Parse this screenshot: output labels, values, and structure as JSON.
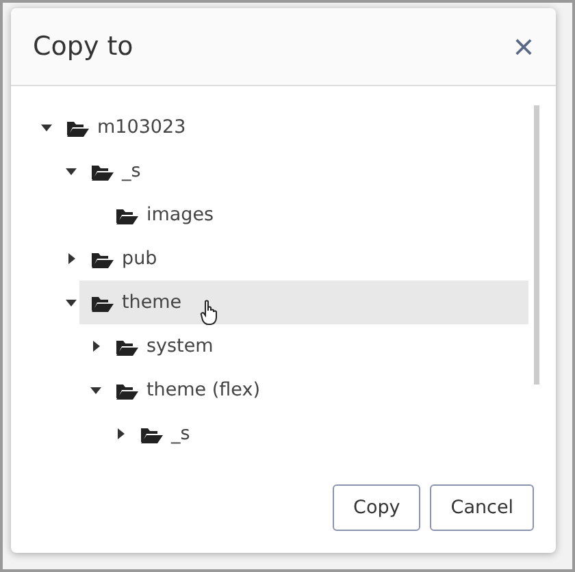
{
  "dialog": {
    "title": "Copy to",
    "close": "×"
  },
  "tree": [
    {
      "label": "m103023",
      "expanded": true,
      "selected": false,
      "children": [
        {
          "label": "_s",
          "expanded": true,
          "selected": false,
          "children": [
            {
              "label": "images",
              "selected": false
            }
          ]
        },
        {
          "label": "pub",
          "expanded": false,
          "selected": false
        },
        {
          "label": "theme",
          "expanded": true,
          "selected": true,
          "children": [
            {
              "label": "system",
              "expanded": false,
              "selected": false
            },
            {
              "label": "theme (flex)",
              "expanded": true,
              "selected": false,
              "children": [
                {
                  "label": "_s",
                  "expanded": false,
                  "selected": false
                }
              ]
            }
          ]
        }
      ]
    }
  ],
  "buttons": [
    "Copy",
    "Cancel"
  ]
}
